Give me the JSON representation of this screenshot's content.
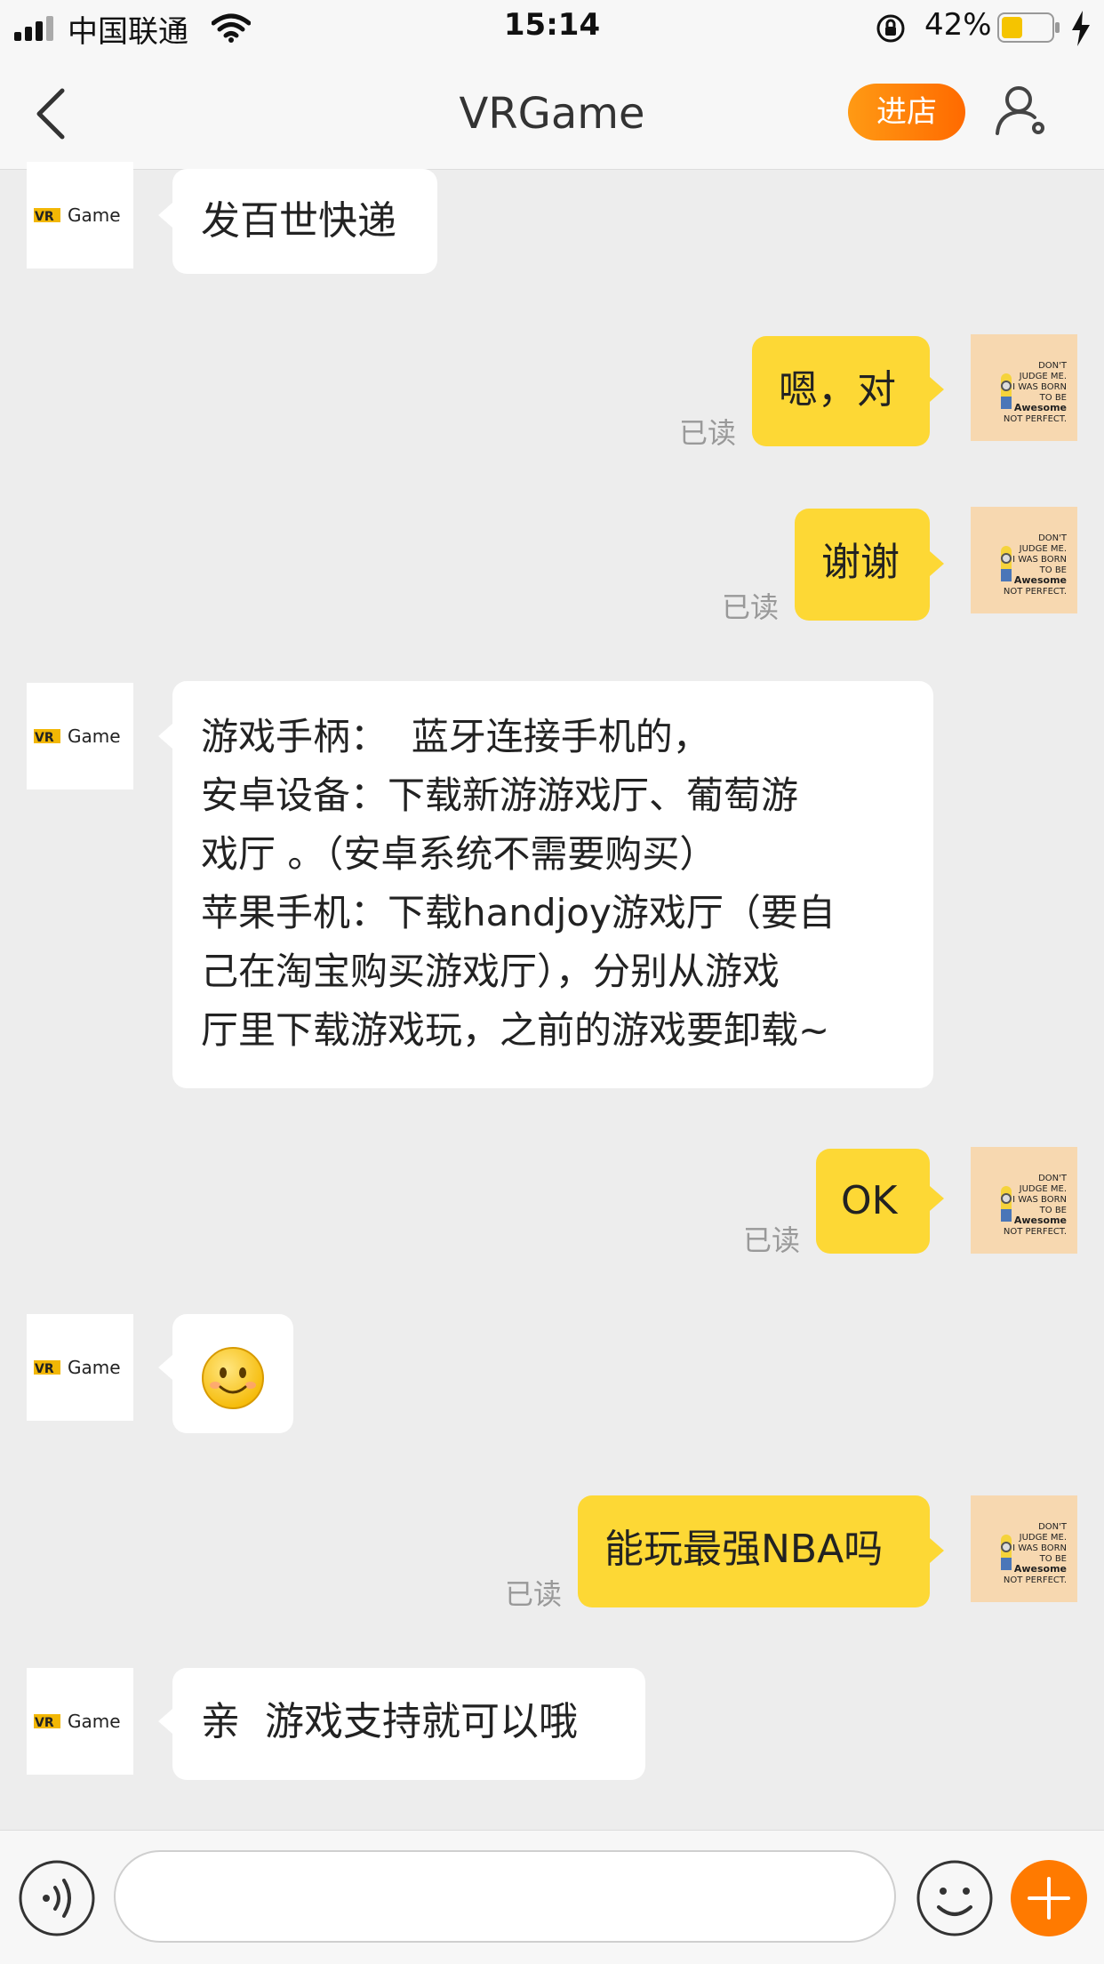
{
  "status_bar": {
    "carrier": "中国联通",
    "time": "15:14",
    "battery_percent": "42%",
    "signal_bars": 3,
    "battery_level": 0.42
  },
  "header": {
    "back_icon": "chevron-left-icon",
    "title": "VRGame",
    "shop_button": "进店",
    "profile_icon": "user-settings-icon"
  },
  "colors": {
    "accent": "#ff7a00",
    "outgoing_bubble": "#fdd835",
    "background": "#ededed"
  },
  "shop_avatar_text": "VR Game",
  "messages": [
    {
      "dir": "in",
      "text": "发百世快递"
    },
    {
      "dir": "out",
      "text": "嗯，对",
      "status": "已读"
    },
    {
      "dir": "out",
      "text": "谢谢",
      "status": "已读"
    },
    {
      "dir": "in",
      "lines": [
        "游戏手柄：  蓝牙连接手机的，",
        "安卓设备：下载新游游戏厅、葡萄游",
        "戏厅 。（安卓系统不需要购买）",
        "苹果手机：下载handjoy游戏厅（要自",
        "己在淘宝购买游戏厅），分别从游戏",
        "厅里下载游戏玩，之前的游戏要卸载~"
      ]
    },
    {
      "dir": "out",
      "text": "OK",
      "status": "已读"
    },
    {
      "dir": "in",
      "emoji": "smile-emoji-icon"
    },
    {
      "dir": "out",
      "text": "能玩最强NBA吗",
      "status": "已读"
    },
    {
      "dir": "in",
      "text": "亲  游戏支持就可以哦"
    }
  ],
  "my_avatar_text": [
    "DON'T",
    "JUDGE ME.",
    "I WAS BORN",
    "TO BE",
    "Awesome",
    "NOT PERFECT."
  ],
  "input_bar": {
    "voice_icon": "voice-icon",
    "input_value": "",
    "emoji_icon": "emoji-icon",
    "add_icon": "plus-icon"
  }
}
